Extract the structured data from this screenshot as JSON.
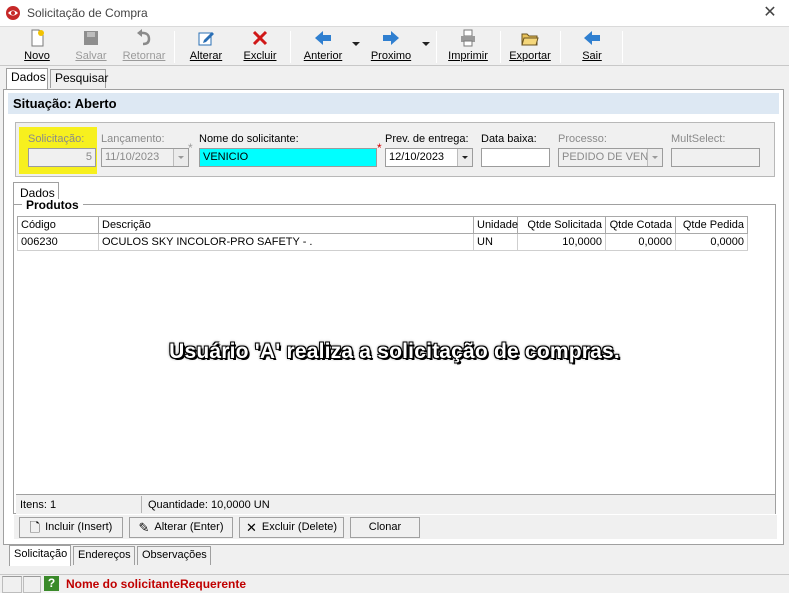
{
  "window": {
    "title": "Solicitação de Compra",
    "close_glyph": "✕",
    "app_icon": "app-logo-icon"
  },
  "toolbar": {
    "novo": "Novo",
    "salvar": "Salvar",
    "retornar": "Retornar",
    "alterar": "Alterar",
    "excluir": "Excluir",
    "anterior": "Anterior",
    "proximo": "Proximo",
    "imprimir": "Imprimir",
    "exportar": "Exportar",
    "sair": "Sair"
  },
  "top_tabs": {
    "dados": "Dados",
    "pesquisar": "Pesquisar"
  },
  "situacao": "Situação: Aberto",
  "form": {
    "solicitacao_label": "Solicitação:",
    "solicitacao_value": "5",
    "lancamento_label": "Lançamento:",
    "lancamento_value": "11/10/2023",
    "nome_label": "Nome do solicitante:",
    "nome_value": "VENICIO",
    "prev_label": "Prev. de entrega:",
    "prev_value": "12/10/2023",
    "data_baixa_label": "Data baixa:",
    "data_baixa_value": "",
    "processo_label": "Processo:",
    "processo_value": "PEDIDO DE VENDA",
    "multiselect_label": "MultSelect:",
    "multiselect_value": "",
    "required_mark": "*"
  },
  "inner_tab": "Dados",
  "produtos": {
    "title": "Produtos",
    "columns": {
      "codigo": "Código",
      "descricao": "Descrição",
      "unidade": "Unidade",
      "qtde_solicitada": "Qtde Solicitada",
      "qtde_cotada": "Qtde Cotada",
      "qtde_pedida": "Qtde Pedida"
    },
    "rows": [
      {
        "codigo": "006230",
        "descricao": "OCULOS SKY INCOLOR-PRO SAFETY - .",
        "unidade": "UN",
        "qtde_solicitada": "10,0000",
        "qtde_cotada": "0,0000",
        "qtde_pedida": "0,0000"
      }
    ],
    "itens": "Itens: 1",
    "quantidade": "Quantidade: 10,0000 UN"
  },
  "overlay_caption": "Usuário 'A' realiza a solicitação de compras.",
  "actions": {
    "incluir": "Incluir (Insert)",
    "alterar": "Alterar (Enter)",
    "excluir": "Excluir (Delete)",
    "clonar": "Clonar"
  },
  "bottom_tabs": {
    "solicitacao": "Solicitação",
    "enderecos": "Endereços",
    "observacoes": "Observações"
  },
  "statusbar": {
    "help_glyph": "?",
    "message": "Nome do solicitanteRequerente"
  },
  "colors": {
    "highlight": "#f7f01e",
    "name_field": "#00ffff",
    "status_band": "#dde8f3",
    "error_text": "#c00000"
  }
}
